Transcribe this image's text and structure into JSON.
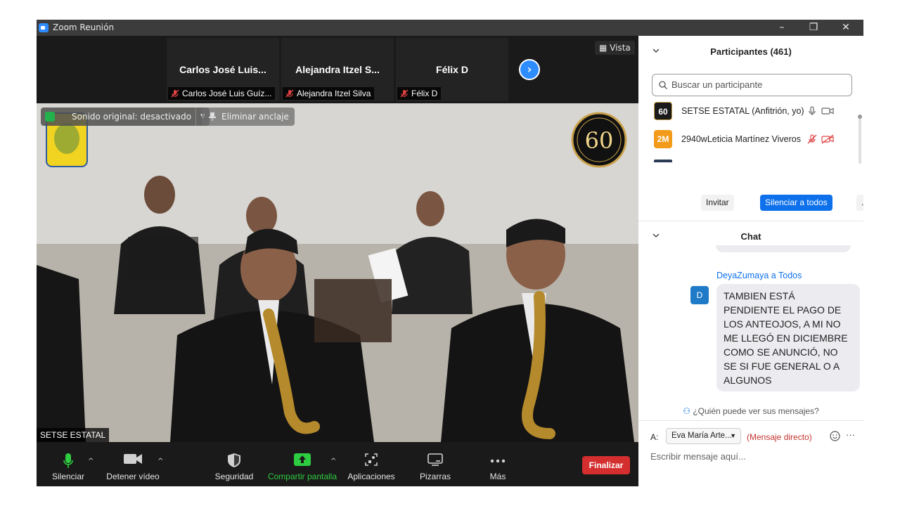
{
  "window": {
    "title": "Zoom Reunión",
    "minimize": "–",
    "restore": "❐",
    "close": "✕"
  },
  "strip": {
    "tiles": [
      {
        "display": "Carlos José Luis...",
        "name": "Carlos José Luis Guíz..."
      },
      {
        "display": "Alejandra Itzel S...",
        "name": "Alejandra Itzel Silva"
      },
      {
        "display": "Félix D",
        "name": "Félix D"
      }
    ],
    "next": "›",
    "view_label": "Vista"
  },
  "main_video": {
    "sound_label": "Sonido original: desactivado",
    "unpin_label": "Eliminar anclaje",
    "speaker_name": "SETSE ESTATAL",
    "badge_number": "60"
  },
  "toolbar": {
    "mute": "Silenciar",
    "stop_video": "Detener vídeo",
    "security": "Seguridad",
    "share": "Compartir pantalla",
    "apps": "Aplicaciones",
    "whiteboards": "Pizarras",
    "more": "Más",
    "end": "Finalizar"
  },
  "participants": {
    "title": "Participantes (461)",
    "search_placeholder": "Buscar un participante",
    "items": [
      {
        "avatar": "60",
        "name": "SETSE ESTATAL (Anfitrión, yo)",
        "avatar_color": "#1a1a1a"
      },
      {
        "avatar": "2M",
        "name": "2940wLeticia Martínez Viveros",
        "avatar_color": "#f29a1a"
      }
    ],
    "invite": "Invitar",
    "mute_all": "Silenciar a todos",
    "more": "..."
  },
  "chat": {
    "title": "Chat",
    "sender": "DeyaZumaya a Todos",
    "avatar": "D",
    "message": "TAMBIEN ESTÁ PENDIENTE EL PAGO DE LOS ANTEOJOS, A MI NO ME LLEGÓ EN DICIEMBRE COMO SE ANUNCIÓ, NO SE SI FUE GENERAL O A ALGUNOS",
    "who_sees": "¿Quién puede ver sus mensajes?",
    "to_label": "A:",
    "recipient": "Eva María Arte...",
    "direct_label": "(Mensaje directo)",
    "more": "···",
    "compose_placeholder": "Escribir mensaje aquí..."
  }
}
